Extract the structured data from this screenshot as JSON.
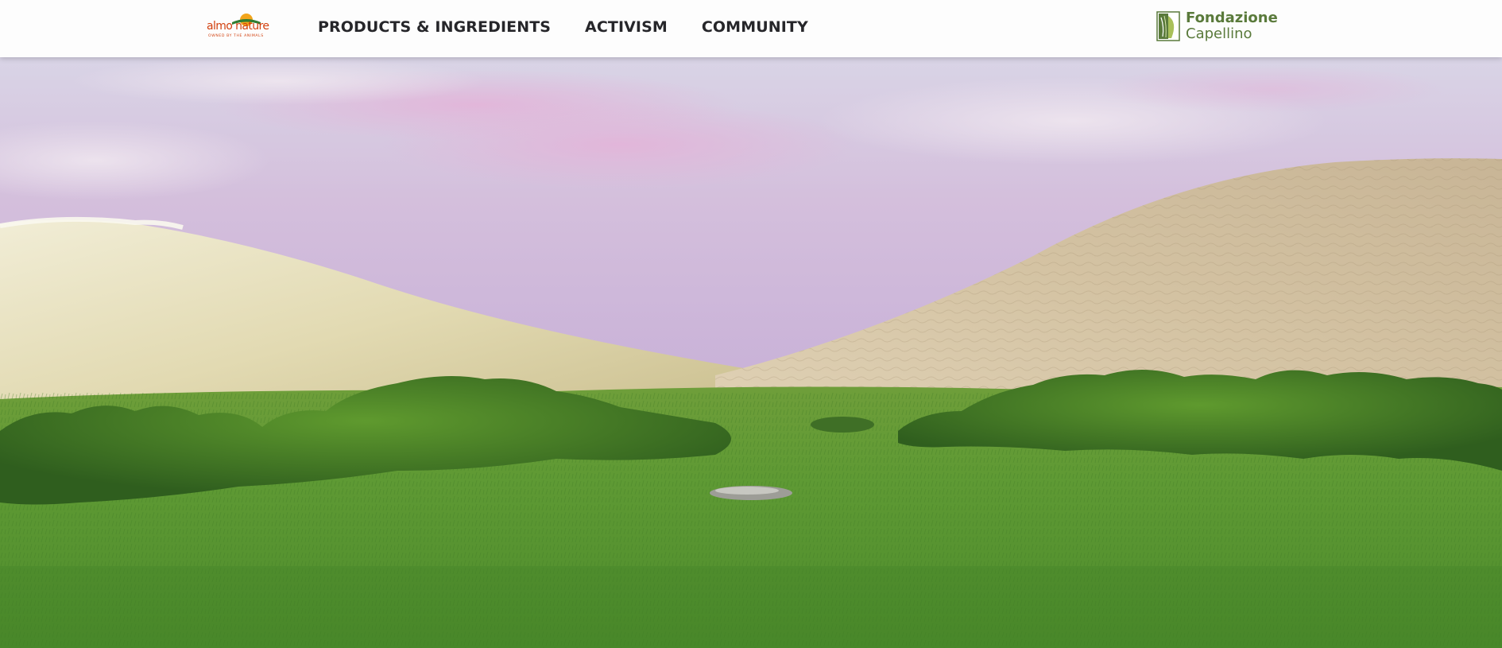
{
  "header": {
    "brand": {
      "name": "almo nature",
      "tagline": "OWNED BY THE ANIMALS"
    },
    "nav": [
      {
        "label": "PRODUCTS & INGREDIENTS"
      },
      {
        "label": "ACTIVISM"
      },
      {
        "label": "COMMUNITY"
      }
    ],
    "foundation": {
      "line1": "Fondazione",
      "line2": "Capellino"
    }
  },
  "colors": {
    "brand_orange": "#d2410f",
    "brand_sun": "#f2a51c",
    "brand_green": "#2f7d32",
    "foundation_green": "#5a7a3b",
    "nav_text": "#26262a"
  },
  "hero": {
    "scene": "pastel-hills-meadow"
  }
}
